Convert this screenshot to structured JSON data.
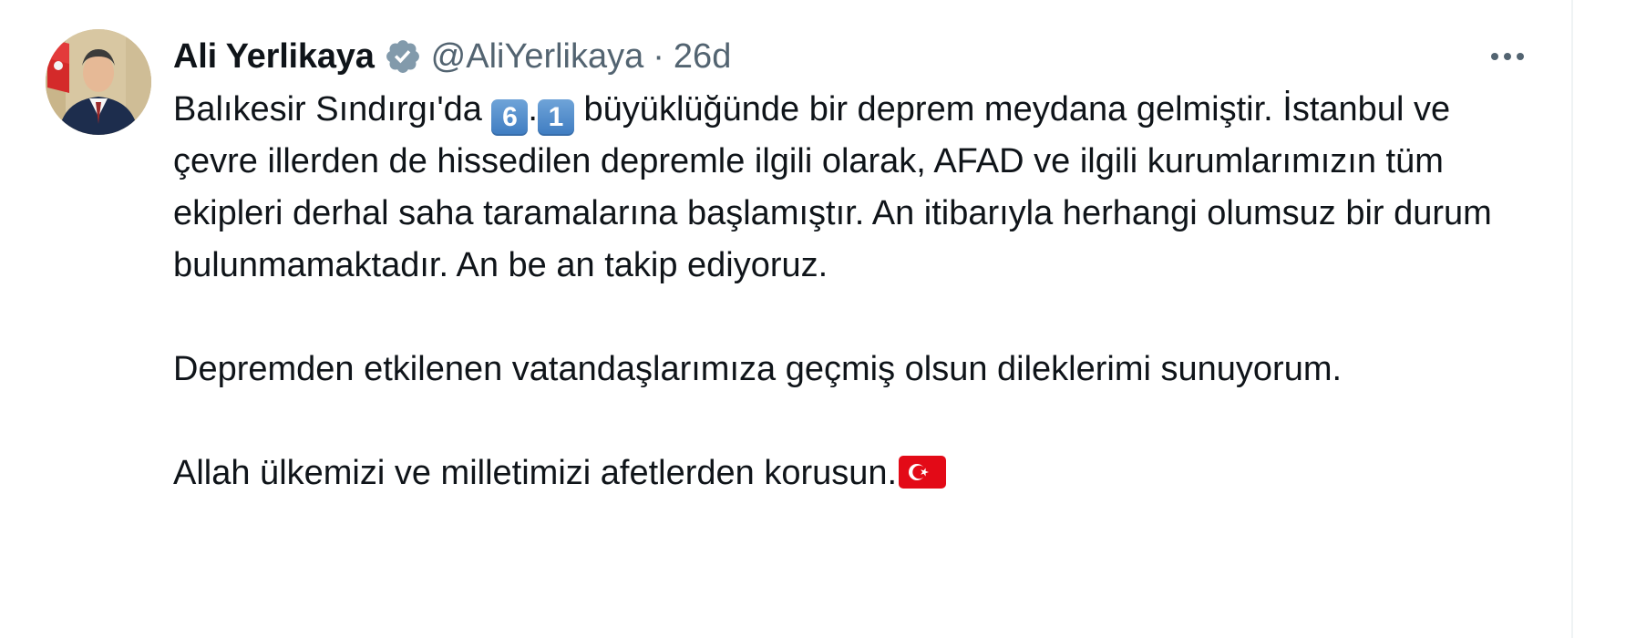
{
  "tweet": {
    "author": {
      "display_name": "Ali Yerlikaya",
      "handle": "@AliYerlikaya",
      "verified": true,
      "verified_icon": "verified-badge-icon"
    },
    "separator": "·",
    "time": "26d",
    "more_icon": "more-horizontal-icon",
    "paragraph1": {
      "before": "Balıkesir Sındırgı'da ",
      "digit1": "6",
      "dot": ".",
      "digit2": "1",
      "after": " büyüklüğünde bir deprem meydana gelmiştir. İstanbul ve çevre illerden de hissedilen depremle ilgili olarak, AFAD ve ilgili kurumlarımızın tüm ekipleri derhal saha taramalarına başlamıştır. An itibarıyla herhangi olumsuz bir durum bulunmamaktadır. An be an takip ediyoruz."
    },
    "paragraph2": "Depremden etkilenen vatandaşlarımıza geçmiş olsun dileklerimi sunuyorum.",
    "paragraph3": "Allah ülkemizi ve milletimizi afetlerden korusun.",
    "flag_icon": "turkey-flag-icon"
  },
  "colors": {
    "text_primary": "#0f1419",
    "text_secondary": "#536471",
    "verified": "#829aab",
    "keycap": "#4a88c7",
    "flag": "#e30a17"
  }
}
